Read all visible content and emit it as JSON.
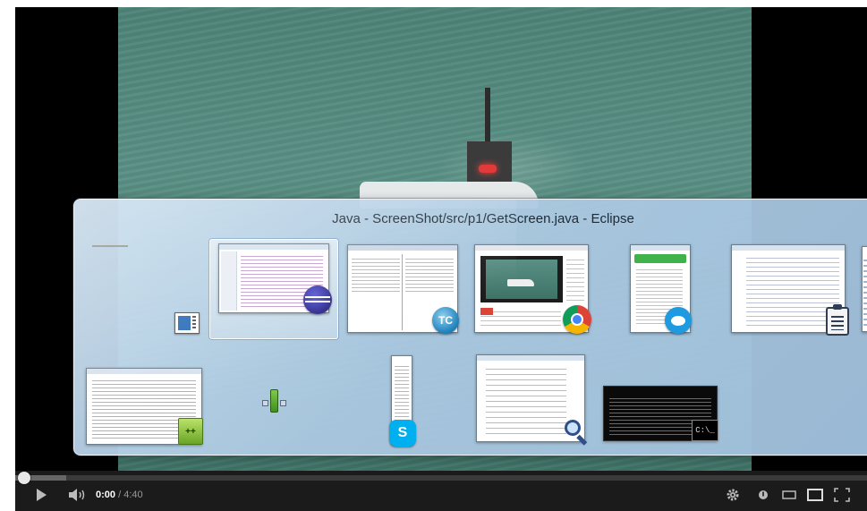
{
  "player": {
    "time_current": "0:00",
    "time_total": "/ 4:40",
    "progress": 0.0,
    "buffered": 0.06
  },
  "switcher": {
    "title": "Java - ScreenShot/src/p1/GetScreen.java - Eclipse",
    "windows_row1": [
      {
        "app": "desktop",
        "icon": "desktop-icon"
      },
      {
        "app": "eclipse",
        "icon": "eclipse-icon",
        "selected": true
      },
      {
        "app": "total-commander",
        "icon": "total-commander-icon"
      },
      {
        "app": "chrome",
        "icon": "chrome-icon"
      },
      {
        "app": "chat",
        "icon": "chat-icon"
      },
      {
        "app": "document-viewer",
        "icon": "clipboard-icon"
      }
    ],
    "windows_row2": [
      {
        "app": "notepad++",
        "icon": "notepadpp-icon"
      },
      {
        "app": "gadget",
        "icon": "gadget-icon"
      },
      {
        "app": "skype",
        "icon": "skype-icon",
        "glyph": "S"
      },
      {
        "app": "snipping",
        "icon": "magnifier-icon"
      },
      {
        "app": "command-prompt",
        "icon": "cmd-icon",
        "glyph": "C:\\_"
      }
    ]
  },
  "colors": {
    "player_bg": "#000000",
    "controls_bg": "#1b1b1b",
    "switcher_glass": "#b4cde3",
    "chrome_red": "#db4437",
    "skype_blue": "#00aff0",
    "chat_blue": "#1e9be0"
  }
}
